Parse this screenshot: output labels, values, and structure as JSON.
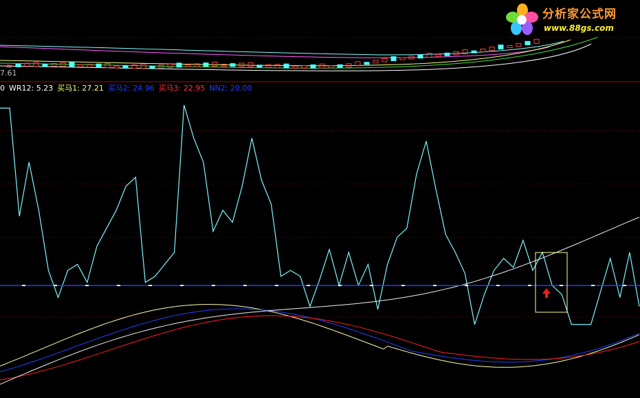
{
  "logo": {
    "title": "分析家公式网",
    "url": "www.88gs.com"
  },
  "price_panel": {
    "last_price_label": "7.61"
  },
  "legend": {
    "items": [
      {
        "text": "0",
        "color": "#ffffff"
      },
      {
        "text": "WR12: 5.23",
        "color": "#ffffff"
      },
      {
        "text": "买马1: 27.21",
        "color": "#ffff80"
      },
      {
        "text": "买马2: 24.96",
        "color": "#2040ff"
      },
      {
        "text": "买马3: 22.95",
        "color": "#ff3030"
      },
      {
        "text": "NN2: 20.00",
        "color": "#2040ff"
      }
    ]
  },
  "colors": {
    "background": "#000000",
    "grid": "#800000",
    "wr_line": "#7ff6ff",
    "ma1_line": "#ffffb0",
    "ma2_line": "#2040ff",
    "ma3_line": "#ff2020",
    "nn_line": "#2040ff",
    "signal_arrow": "#ff1a1a",
    "highlight_box": "#ffff99"
  },
  "chart_data": {
    "type": "line",
    "ylim": [
      0,
      100
    ],
    "grid": true,
    "series": [
      {
        "name": "WR12",
        "values": [
          96,
          96,
          60,
          78,
          62,
          42,
          33,
          42,
          44,
          38,
          50,
          56,
          62,
          70,
          73,
          38,
          40,
          44,
          48,
          97,
          86,
          78,
          55,
          62,
          58,
          70,
          86,
          72,
          64,
          40,
          42,
          40,
          30,
          39,
          49,
          37,
          48,
          37,
          44,
          29,
          44,
          53,
          56,
          74,
          85,
          69,
          54,
          48,
          41,
          24,
          34,
          42,
          46,
          43,
          52,
          42,
          48,
          37,
          34,
          24,
          24,
          24,
          35,
          46,
          33,
          48,
          30
        ]
      },
      {
        "name": "买马1",
        "values": [
          27.21
        ]
      },
      {
        "name": "买马2",
        "values": [
          24.96
        ]
      },
      {
        "name": "买马3",
        "values": [
          22.95
        ]
      },
      {
        "name": "NN2",
        "values": [
          20.0
        ]
      }
    ],
    "signal": {
      "type": "buy-arrow"
    }
  }
}
